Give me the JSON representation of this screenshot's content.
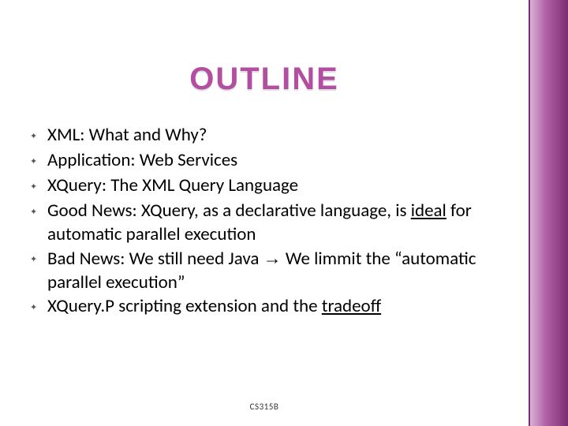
{
  "title": "OUTLINE",
  "bullets": {
    "b0": "XML: What and Why?",
    "b1": "Application: Web Services",
    "b2": "XQuery: The XML Query Language",
    "b3_a": "Good News: XQuery, as a declarative language, is ",
    "b3_u": "ideal",
    "b3_b": " for automatic parallel execution",
    "b4_a": "Bad News: We still need Java ",
    "b4_arrow": "→",
    "b4_b": " We limmit the “automatic parallel execution”",
    "b5_a": "XQuery.P scripting extension and the ",
    "b5_u": "tradeoff"
  },
  "footer": "CS315B"
}
